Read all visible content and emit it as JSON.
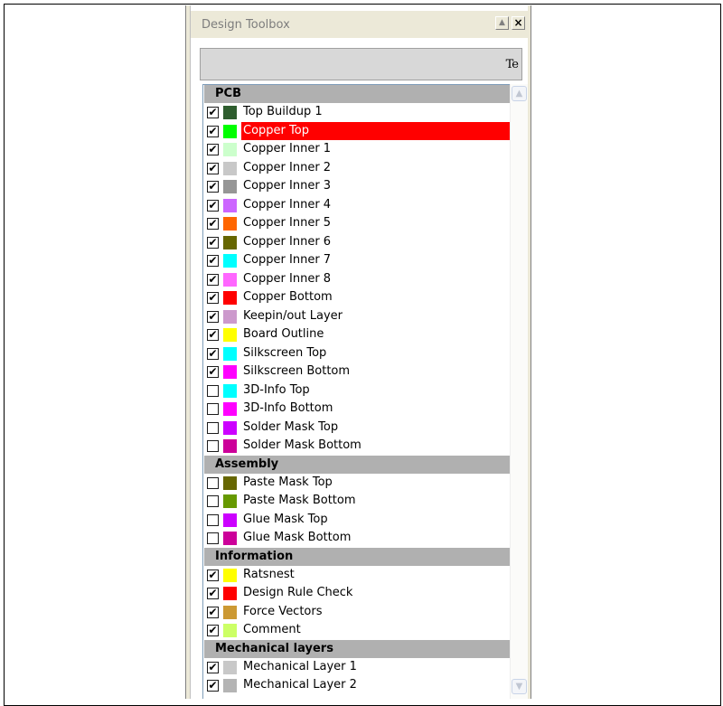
{
  "window": {
    "title": "Design Toolbox",
    "minimize_glyph": "▲",
    "close_glyph": "×"
  },
  "toolbar": {
    "icon_glyph": "Te",
    "icon_name": "text-tool-icon"
  },
  "groups": [
    {
      "name": "PCB",
      "items": [
        {
          "label": "Top Buildup 1",
          "checked": true,
          "color": "#2e5d2e"
        },
        {
          "label": "Copper Top",
          "checked": true,
          "color": "#00ff00",
          "selected": true
        },
        {
          "label": "Copper Inner 1",
          "checked": true,
          "color": "#ccffcc"
        },
        {
          "label": "Copper Inner 2",
          "checked": true,
          "color": "#c8c8c8"
        },
        {
          "label": "Copper Inner 3",
          "checked": true,
          "color": "#969696"
        },
        {
          "label": "Copper Inner 4",
          "checked": true,
          "color": "#cc66ff"
        },
        {
          "label": "Copper Inner 5",
          "checked": true,
          "color": "#ff6600"
        },
        {
          "label": "Copper Inner 6",
          "checked": true,
          "color": "#666600"
        },
        {
          "label": "Copper Inner 7",
          "checked": true,
          "color": "#00ffff"
        },
        {
          "label": "Copper Inner 8",
          "checked": true,
          "color": "#ff66ff"
        },
        {
          "label": "Copper Bottom",
          "checked": true,
          "color": "#ff0000"
        },
        {
          "label": "Keepin/out Layer",
          "checked": true,
          "color": "#cc99cc"
        },
        {
          "label": "Board Outline",
          "checked": true,
          "color": "#ffff00"
        },
        {
          "label": "Silkscreen Top",
          "checked": true,
          "color": "#00ffff"
        },
        {
          "label": "Silkscreen Bottom",
          "checked": true,
          "color": "#ff00ff"
        },
        {
          "label": "3D-Info Top",
          "checked": false,
          "color": "#00ffff"
        },
        {
          "label": "3D-Info Bottom",
          "checked": false,
          "color": "#ff00ff"
        },
        {
          "label": "Solder Mask Top",
          "checked": false,
          "color": "#cc00ff"
        },
        {
          "label": "Solder Mask Bottom",
          "checked": false,
          "color": "#cc0099"
        }
      ]
    },
    {
      "name": "Assembly",
      "items": [
        {
          "label": "Paste Mask Top",
          "checked": false,
          "color": "#666600"
        },
        {
          "label": "Paste Mask Bottom",
          "checked": false,
          "color": "#669900"
        },
        {
          "label": "Glue Mask Top",
          "checked": false,
          "color": "#cc00ff"
        },
        {
          "label": "Glue Mask Bottom",
          "checked": false,
          "color": "#cc0099"
        }
      ]
    },
    {
      "name": "Information",
      "items": [
        {
          "label": "Ratsnest",
          "checked": true,
          "color": "#ffff00"
        },
        {
          "label": "Design Rule Check",
          "checked": true,
          "color": "#ff0000"
        },
        {
          "label": "Force Vectors",
          "checked": true,
          "color": "#cc9933"
        },
        {
          "label": "Comment",
          "checked": true,
          "color": "#ccff66"
        }
      ]
    },
    {
      "name": "Mechanical layers",
      "items": [
        {
          "label": "Mechanical Layer 1",
          "checked": true,
          "color": "#c8c8c8"
        },
        {
          "label": "Mechanical Layer 2",
          "checked": true,
          "color": "#b4b4b4"
        }
      ]
    }
  ],
  "scrollbar": {
    "up_glyph": "▲",
    "down_glyph": "▼"
  }
}
